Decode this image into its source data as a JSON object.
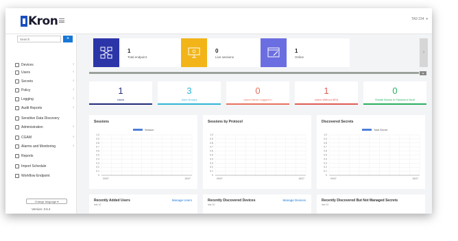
{
  "app": {
    "logo_text": "Kron",
    "user": "TA9 234"
  },
  "sidebar": {
    "search_placeholder": "Search",
    "items": [
      {
        "label": "Devices",
        "icon": "devices-icon",
        "has_children": true
      },
      {
        "label": "Users",
        "icon": "users-icon",
        "has_children": true
      },
      {
        "label": "Secrets",
        "icon": "secrets-icon",
        "has_children": true
      },
      {
        "label": "Policy",
        "icon": "policy-icon",
        "has_children": true
      },
      {
        "label": "Logging",
        "icon": "logging-icon",
        "has_children": true
      },
      {
        "label": "Audit Reports",
        "icon": "report-icon",
        "has_children": true
      },
      {
        "label": "Sensitive Data Discovery",
        "icon": "discovery-icon",
        "has_children": false
      },
      {
        "label": "Administration",
        "icon": "admin-icon",
        "has_children": true
      },
      {
        "label": "CGAM",
        "icon": "cgam-icon",
        "has_children": true
      },
      {
        "label": "Alarms and Monitoring",
        "icon": "alarm-icon",
        "has_children": true
      },
      {
        "label": "Reports",
        "icon": "reports-icon",
        "has_children": false
      },
      {
        "label": "Import Schedule",
        "icon": "import-icon",
        "has_children": false
      },
      {
        "label": "Workflow Endpoint",
        "icon": "workflow-icon",
        "has_children": false
      }
    ],
    "language_button": "Change language",
    "version": "Version: 3.5.4"
  },
  "stats": [
    {
      "value": "1",
      "label": "Total endpoint",
      "color": "#2c35a8"
    },
    {
      "value": "0",
      "label": "Live sessions",
      "color": "#f2b418"
    },
    {
      "value": "1",
      "label": "Online",
      "color": "#6b6ee0"
    }
  ],
  "metrics": [
    {
      "value": "1",
      "label": "Users",
      "color": "#1e2a78"
    },
    {
      "value": "3",
      "label": "User Groups",
      "color": "#2cb4d6"
    },
    {
      "value": "0",
      "label": "Users Never Logged In",
      "color": "#e8705a"
    },
    {
      "value": "1",
      "label": "Users Without MFA",
      "color": "#e05a50"
    },
    {
      "value": "0",
      "label": "Rotate Blocks in Password Vault",
      "color": "#27ae60"
    }
  ],
  "panels": [
    {
      "title": "Sessions",
      "legend": "Session",
      "x_left": "09/07",
      "x_right": "15/07"
    },
    {
      "title": "Sessions by Protocol",
      "legend": "",
      "x_left": "09/07",
      "x_right": "15/07"
    },
    {
      "title": "Discovered Secrets",
      "legend": "Total Secret",
      "x_left": "09/07",
      "x_right": "15/07"
    }
  ],
  "y_ticks": [
    "1.0",
    "0.9",
    "0.8",
    "0.7",
    "0.6",
    "0.5",
    "0.4",
    "0.3",
    "0.2",
    "0.1",
    "0"
  ],
  "bottom_panels": [
    {
      "title": "Recently Added Users",
      "sub": "last 10",
      "link": "Manage Users"
    },
    {
      "title": "Recently Discovered Devices",
      "sub": "last 10",
      "link": "Manage Devices"
    },
    {
      "title": "Recently Discovered But Not Managed Secrets",
      "sub": "last 10",
      "link": ""
    }
  ]
}
